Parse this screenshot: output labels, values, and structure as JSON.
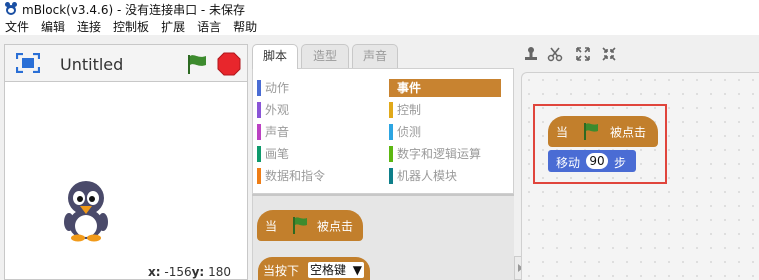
{
  "window": {
    "title": "mBlock(v3.4.6) - 没有连接串口 - 未保存"
  },
  "menu": [
    "文件",
    "编辑",
    "连接",
    "控制板",
    "扩展",
    "语言",
    "帮助"
  ],
  "stage": {
    "title": "Untitled",
    "coords": {
      "x_label": "x:",
      "x_value": "-156",
      "y_label": "y:",
      "y_value": "180"
    }
  },
  "tabs": [
    "脚本",
    "造型",
    "声音"
  ],
  "categories": [
    {
      "label": "动作",
      "color": "#4a6cd4",
      "selected": false
    },
    {
      "label": "事件",
      "color": "#c88330",
      "selected": true
    },
    {
      "label": "外观",
      "color": "#8a55d7",
      "selected": false
    },
    {
      "label": "控制",
      "color": "#e1a91a",
      "selected": false
    },
    {
      "label": "声音",
      "color": "#bb42c3",
      "selected": false
    },
    {
      "label": "侦测",
      "color": "#2ca5e2",
      "selected": false
    },
    {
      "label": "画笔",
      "color": "#0e9a6c",
      "selected": false
    },
    {
      "label": "数字和逻辑运算",
      "color": "#5cb712",
      "selected": false
    },
    {
      "label": "数据和指令",
      "color": "#ee7d16",
      "selected": false
    },
    {
      "label": "机器人模块",
      "color": "#0e7f8a",
      "selected": false
    }
  ],
  "palette": {
    "flag_block": {
      "when": "当",
      "clicked": "被点击"
    },
    "key_block": {
      "label": "当按下",
      "key": "空格键"
    }
  },
  "script": {
    "hat": {
      "when": "当",
      "clicked": "被点击"
    },
    "move": {
      "label": "移动",
      "value": "90",
      "unit": "步"
    }
  },
  "colors": {
    "event_block": "#c27f2c",
    "motion_block": "#4a6cd4",
    "highlight": "#e0453c",
    "stop": "#e8262c",
    "flag": "#3d8b2e"
  }
}
